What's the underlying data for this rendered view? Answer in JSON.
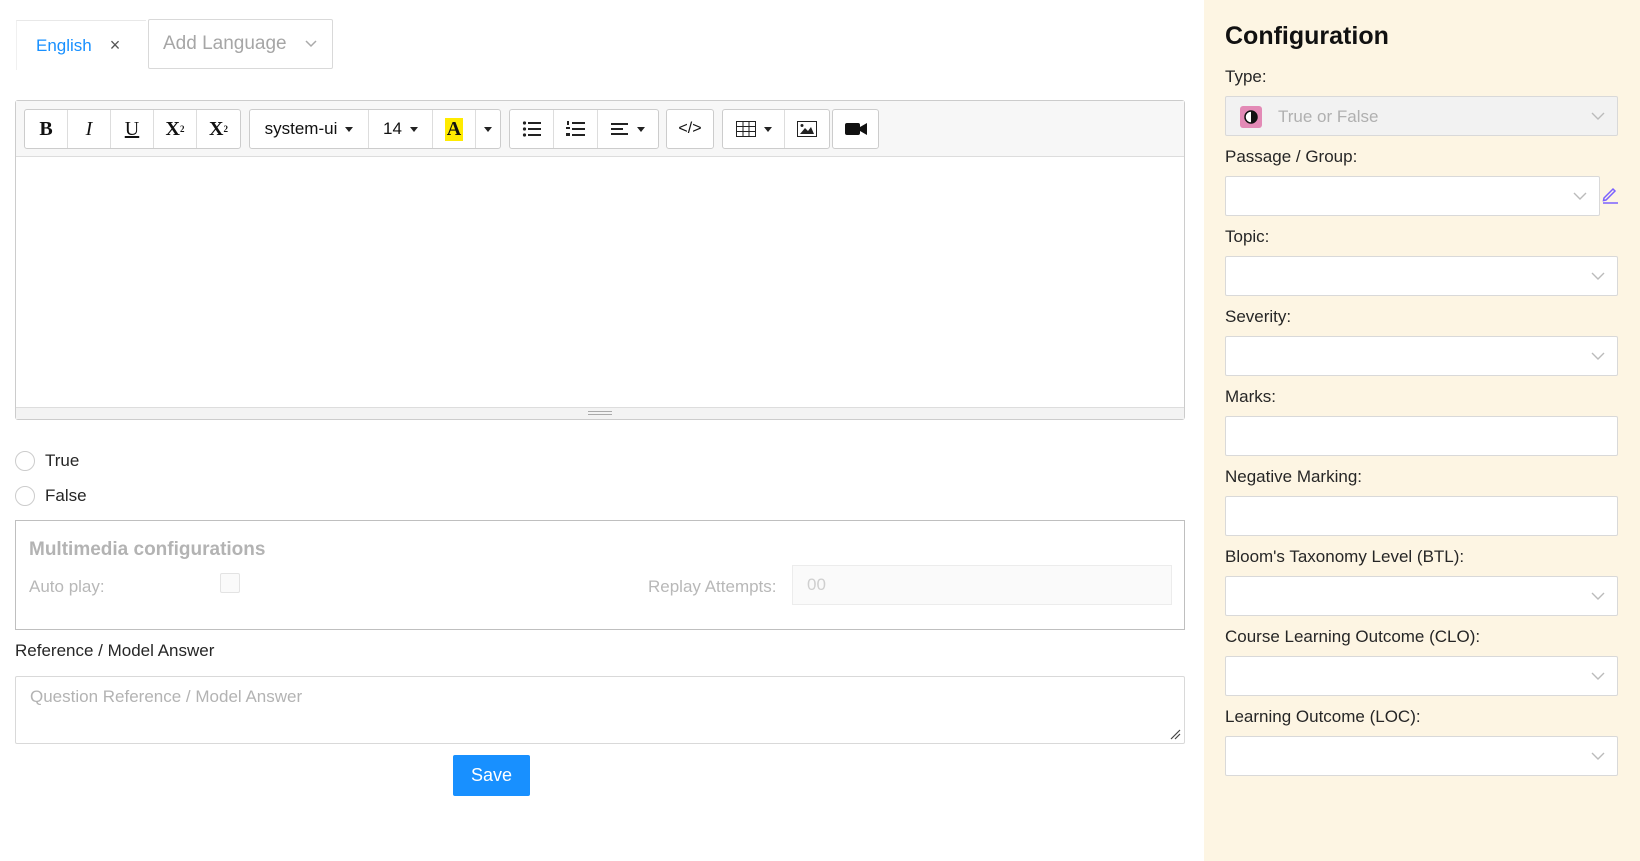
{
  "languages": {
    "active_tab": "English",
    "add_placeholder": "Add Language"
  },
  "toolbar": {
    "bold": "B",
    "italic": "I",
    "underline": "U",
    "superscript": "X",
    "subscript": "X",
    "font_family": "system-ui",
    "font_size": "14",
    "highlight_letter": "A",
    "code": "</>"
  },
  "answers": {
    "true_label": "True",
    "false_label": "False"
  },
  "multimedia": {
    "title": "Multimedia configurations",
    "autoplay_label": "Auto play:",
    "replay_label": "Replay Attempts:",
    "replay_value": "00"
  },
  "reference": {
    "label": "Reference / Model Answer",
    "placeholder": "Question Reference / Model Answer"
  },
  "save_label": "Save",
  "config": {
    "title": "Configuration",
    "type_label": "Type:",
    "type_value": "True or False",
    "passage_label": "Passage / Group:",
    "topic_label": "Topic:",
    "severity_label": "Severity:",
    "marks_label": "Marks:",
    "negative_label": "Negative Marking:",
    "btl_label": "Bloom's Taxonomy Level (BTL):",
    "clo_label": "Course Learning Outcome (CLO):",
    "loc_label": "Learning Outcome (LOC):"
  },
  "colors": {
    "primary": "#1890ff",
    "sidebar_bg": "#fdf5e3",
    "type_icon": "#e38ab6",
    "edit_icon": "#7b61ff"
  }
}
